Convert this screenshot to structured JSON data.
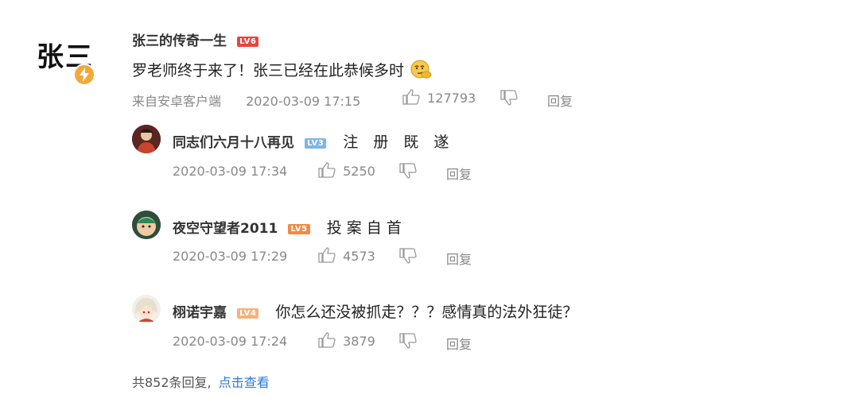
{
  "main_comment": {
    "avatar_text": "张三",
    "username": "张三的传奇一生",
    "level": "LV6",
    "text": "罗老师终于来了！张三已经在此恭候多时",
    "emoji": "thinking-face",
    "source": "来自安卓客户端",
    "timestamp": "2020-03-09 17:15",
    "likes": "127793",
    "reply_label": "回复"
  },
  "replies": [
    {
      "username": "同志们六月十八再见",
      "level": "LV3",
      "text": "注　册　既　遂",
      "timestamp": "2020-03-09 17:34",
      "likes": "5250",
      "reply_label": "回复"
    },
    {
      "username": "夜空守望者2011",
      "level": "LV5",
      "text": "投 案 自 首",
      "timestamp": "2020-03-09 17:29",
      "likes": "4573",
      "reply_label": "回复"
    },
    {
      "username": "栩诺宇嘉",
      "level": "LV4",
      "text": "你怎么还没被抓走？？？感情真的法外狂徒？",
      "timestamp": "2020-03-09 17:24",
      "likes": "3879",
      "reply_label": "回复"
    }
  ],
  "footer": {
    "total_text": "共852条回复,",
    "view_link": "点击查看"
  },
  "colors": {
    "link": "#2f7bd6",
    "lv6": "#e8453c",
    "lv3": "#7bb6e8",
    "lv5": "#f08a45",
    "lv4": "#f4b37a",
    "bolt": "#f3a83a"
  }
}
